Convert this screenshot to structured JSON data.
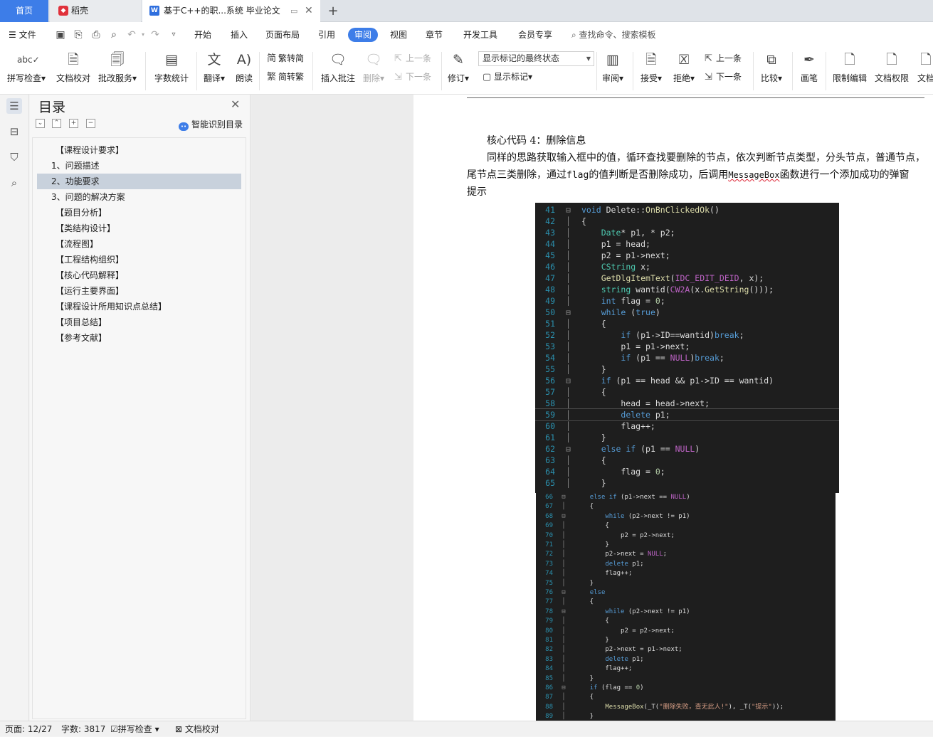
{
  "tabs": {
    "home": "首页",
    "daoke": "稻壳",
    "doc": "基于C++的职...系统 毕业论文",
    "add": "+"
  },
  "menu": {
    "file": "文件",
    "items": [
      "开始",
      "插入",
      "页面布局",
      "引用",
      "审阅",
      "视图",
      "章节",
      "开发工具",
      "会员专享"
    ],
    "active": "审阅",
    "search": "查找命令、搜索模板"
  },
  "ribbon": {
    "spell": "拼写检查",
    "proof": "文档校对",
    "review_service": "批改服务",
    "word_count": "字数统计",
    "translate": "翻译",
    "read_aloud": "朗读",
    "trad_to_simp": "繁转简",
    "simp_to_trad": "简转繁",
    "insert_comment": "插入批注",
    "delete": "删除",
    "prev_comment": "上一条",
    "next_comment": "下一条",
    "track": "修订",
    "markup_state": "显示标记的最终状态",
    "show_markup": "显示标记",
    "review": "审阅",
    "accept": "接受",
    "reject": "拒绝",
    "prev_change": "上一条",
    "next_change": "下一条",
    "compare": "比较",
    "pen": "画笔",
    "restrict": "限制编辑",
    "permission": "文档权限",
    "doc_more": "文档"
  },
  "nav": {
    "title": "目录",
    "smart": "智能识别目录",
    "items": [
      "【课程设计要求】",
      "1、问题描述",
      "2、功能要求",
      "3、问题的解决方案",
      "【题目分析】",
      "【类结构设计】",
      "【流程图】",
      "【工程结构组织】",
      "【核心代码解释】",
      "【运行主要界面】",
      "【课程设计所用知识点总结】",
      "【项目总结】",
      "【参考文献】"
    ],
    "selected": "2、功能要求"
  },
  "doc": {
    "heading": "核心代码 4：删除信息",
    "para_line1": "同样的思路获取输入框中的值，循环查找要删除的节点，依次判断节点类型，分头节点，普通节点，",
    "para_line2_a": "尾节点三类删除，通过",
    "para_line2_flag": "flag",
    "para_line2_b": "的值判断是否删除成功，后调用",
    "para_line2_msgbox": "MessageBox",
    "para_line2_c": "函数进行一个添加成功的弹窗",
    "para_line3": "提示"
  },
  "code_block_1": {
    "lines": [
      {
        "n": "41",
        "g": "⊟",
        "t": "void Delete::OnBnClickedOk()"
      },
      {
        "n": "42",
        "g": "│",
        "t": "{"
      },
      {
        "n": "43",
        "g": "│",
        "t": "    Date* p1, * p2;"
      },
      {
        "n": "44",
        "g": "│",
        "t": "    p1 = head;"
      },
      {
        "n": "45",
        "g": "│",
        "t": "    p2 = p1->next;"
      },
      {
        "n": "46",
        "g": "│",
        "t": "    CString x;"
      },
      {
        "n": "47",
        "g": "│",
        "t": "    GetDlgItemText(IDC_EDIT_DEID, x);"
      },
      {
        "n": "48",
        "g": "│",
        "t": "    string wantid(CW2A(x.GetString()));"
      },
      {
        "n": "49",
        "g": "│",
        "t": "    int flag = 0;"
      },
      {
        "n": "50",
        "g": "⊟",
        "t": "    while (true)"
      },
      {
        "n": "51",
        "g": "│",
        "t": "    {"
      },
      {
        "n": "52",
        "g": "│",
        "t": "        if (p1->ID==wantid)break;"
      },
      {
        "n": "53",
        "g": "│",
        "t": "        p1 = p1->next;"
      },
      {
        "n": "54",
        "g": "│",
        "t": "        if (p1 == NULL)break;"
      },
      {
        "n": "55",
        "g": "│",
        "t": "    }"
      },
      {
        "n": "56",
        "g": "⊟",
        "t": "    if (p1 == head && p1->ID == wantid)"
      },
      {
        "n": "57",
        "g": "│",
        "t": "    {"
      },
      {
        "n": "58",
        "g": "│",
        "t": "        head = head->next;"
      },
      {
        "n": "59",
        "g": "│",
        "t": "        delete p1;"
      },
      {
        "n": "60",
        "g": "│",
        "t": "        flag++;"
      },
      {
        "n": "61",
        "g": "│",
        "t": "    }"
      },
      {
        "n": "62",
        "g": "⊟",
        "t": "    else if (p1 == NULL)"
      },
      {
        "n": "63",
        "g": "│",
        "t": "    {"
      },
      {
        "n": "64",
        "g": "│",
        "t": "        flag = 0;"
      },
      {
        "n": "65",
        "g": "│",
        "t": "    }"
      }
    ]
  },
  "code_block_2": {
    "lines": [
      {
        "n": "66",
        "g": "⊟",
        "t": "    else if (p1->next == NULL)"
      },
      {
        "n": "67",
        "g": "│",
        "t": "    {"
      },
      {
        "n": "68",
        "g": "⊟",
        "t": "        while (p2->next != p1)"
      },
      {
        "n": "69",
        "g": "│",
        "t": "        {"
      },
      {
        "n": "70",
        "g": "│",
        "t": "            p2 = p2->next;"
      },
      {
        "n": "71",
        "g": "│",
        "t": "        }"
      },
      {
        "n": "72",
        "g": "│",
        "t": "        p2->next = NULL;"
      },
      {
        "n": "73",
        "g": "│",
        "t": "        delete p1;"
      },
      {
        "n": "74",
        "g": "│",
        "t": "        flag++;"
      },
      {
        "n": "75",
        "g": "│",
        "t": "    }"
      },
      {
        "n": "76",
        "g": "⊟",
        "t": "    else"
      },
      {
        "n": "77",
        "g": "│",
        "t": "    {"
      },
      {
        "n": "78",
        "g": "⊟",
        "t": "        while (p2->next != p1)"
      },
      {
        "n": "79",
        "g": "│",
        "t": "        {"
      },
      {
        "n": "80",
        "g": "│",
        "t": "            p2 = p2->next;"
      },
      {
        "n": "81",
        "g": "│",
        "t": "        }"
      },
      {
        "n": "82",
        "g": "│",
        "t": "        p2->next = p1->next;"
      },
      {
        "n": "83",
        "g": "│",
        "t": "        delete p1;"
      },
      {
        "n": "84",
        "g": "│",
        "t": "        flag++;"
      },
      {
        "n": "85",
        "g": "│",
        "t": "    }"
      },
      {
        "n": "86",
        "g": "⊟",
        "t": "    if (flag == 0)"
      },
      {
        "n": "87",
        "g": "│",
        "t": "    {"
      },
      {
        "n": "88",
        "g": "│",
        "t": "        MessageBox(_T(\"删除失败，查无此人!\"), _T(\"提示\"));"
      },
      {
        "n": "89",
        "g": "│",
        "t": "    }"
      }
    ]
  },
  "status": {
    "page": "页面: 12/27",
    "words": "字数: 3817",
    "spell": "拼写检查",
    "proof": "文档校对"
  }
}
